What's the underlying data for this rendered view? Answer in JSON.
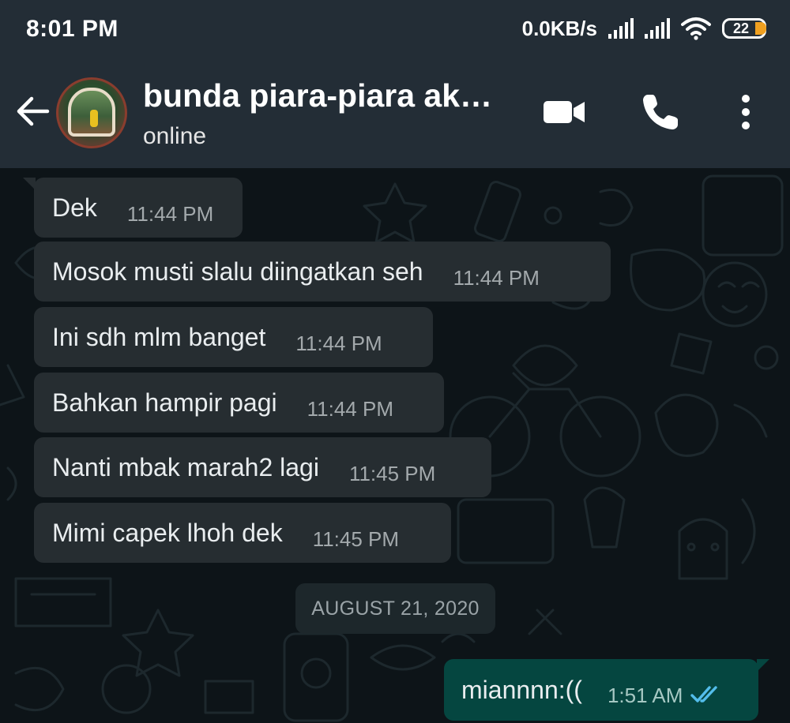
{
  "status_bar": {
    "time": "8:01 PM",
    "net_speed": "0.0KB/s",
    "battery": "22",
    "icons": [
      "signal-icon",
      "signal-icon",
      "wifi-icon",
      "battery-icon"
    ]
  },
  "header": {
    "contact_name": "bunda piara-piara ak…",
    "contact_status": "online",
    "icons": [
      "back-arrow-icon",
      "avatar",
      "video-camera-icon",
      "phone-icon",
      "more-vertical-icon"
    ]
  },
  "messages": [
    {
      "text": "Dek",
      "time": "11:44 PM",
      "direction": "incoming"
    },
    {
      "text": "Mosok musti slalu diingatkan seh",
      "time": "11:44 PM",
      "direction": "incoming"
    },
    {
      "text": "Ini sdh mlm banget",
      "time": "11:44 PM",
      "direction": "incoming"
    },
    {
      "text": "Bahkan hampir pagi",
      "time": "11:44 PM",
      "direction": "incoming"
    },
    {
      "text": "Nanti mbak marah2 lagi",
      "time": "11:45 PM",
      "direction": "incoming"
    },
    {
      "text": "Mimi capek lhoh dek",
      "time": "11:45 PM",
      "direction": "incoming"
    }
  ],
  "date_divider": "AUGUST 21, 2020",
  "outgoing_message": {
    "text": "miannnn:((",
    "time": "1:51 AM",
    "status": "read"
  },
  "colors": {
    "header_bg": "#232d36",
    "chat_bg": "#0d1418",
    "incoming_bubble": "#262d31",
    "outgoing_bubble": "#054640",
    "read_ticks": "#53bdeb"
  }
}
